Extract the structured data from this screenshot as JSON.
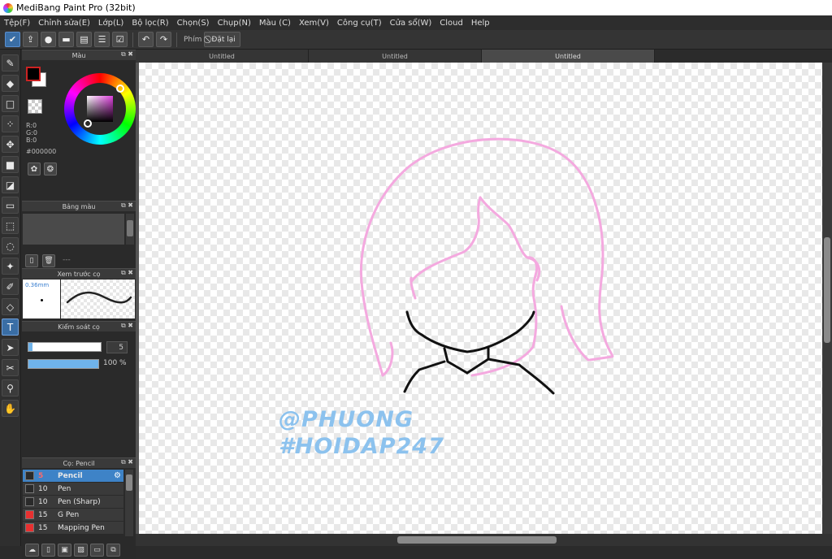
{
  "window": {
    "title": "MediBang Paint Pro (32bit)"
  },
  "menu": [
    "Tệp(F)",
    "Chỉnh sửa(E)",
    "Lớp(L)",
    "Bộ lọc(R)",
    "Chọn(S)",
    "Chụp(N)",
    "Màu (C)",
    "Xem(V)",
    "Công cụ(T)",
    "Cửa sổ(W)",
    "Cloud",
    "Help"
  ],
  "toolbar": {
    "key_label": "Phím",
    "reset_label": "Đặt lại"
  },
  "panels": {
    "color": {
      "title": "Màu",
      "r": "R:0",
      "g": "G:0",
      "b": "B:0",
      "hex": "#000000"
    },
    "palette": {
      "title": "Bảng màu",
      "placeholder": "---"
    },
    "preview": {
      "title": "Xem trước cọ",
      "size": "0.36mm"
    },
    "control": {
      "title": "Kiểm soát cọ",
      "size": "5",
      "opacity": "100 %"
    },
    "brush": {
      "title": "Cọ: Pencil",
      "items": [
        {
          "size": "5",
          "name": "Pencil",
          "color": "#2a2a2a",
          "active": true
        },
        {
          "size": "10",
          "name": "Pen",
          "color": "#2a2a2a"
        },
        {
          "size": "10",
          "name": "Pen (Sharp)",
          "color": "#2a2a2a"
        },
        {
          "size": "15",
          "name": "G Pen",
          "color": "#e83030"
        },
        {
          "size": "15",
          "name": "Mapping Pen",
          "color": "#e83030"
        }
      ]
    }
  },
  "tabs": [
    "Untitled",
    "Untitled",
    "Untitled"
  ],
  "canvas": {
    "watermark_line1": "@PHUONG",
    "watermark_line2": "#HOIDAP247",
    "stroke_pink": "#f4a9df",
    "stroke_black": "#111111"
  },
  "colors": {
    "accent": "#3e83c7"
  }
}
